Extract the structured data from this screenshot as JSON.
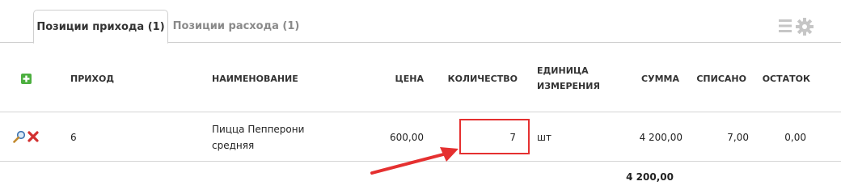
{
  "tabs": [
    {
      "label": "Позиции прихода (1)",
      "active": true
    },
    {
      "label": "Позиции расхода (1)",
      "active": false
    }
  ],
  "toolbar": {
    "icons": [
      "list-icon",
      "gear-icon"
    ]
  },
  "table": {
    "headers": {
      "prihod": "ПРИХОД",
      "name": "НАИМЕНОВАНИЕ",
      "price": "ЦЕНА",
      "qty": "КОЛИЧЕСТВО",
      "unit_line1": "ЕДИНИЦА",
      "unit_line2": "ИЗМЕРЕНИЯ",
      "sum": "СУММА",
      "written_off": "СПИСАНО",
      "rest": "ОСТАТОК"
    },
    "rows": [
      {
        "prihod": "6",
        "name_line1": "Пицца Пепперони",
        "name_line2": "средняя",
        "price": "600,00",
        "qty": "7",
        "unit": "шт",
        "sum": "4 200,00",
        "written_off": "7,00",
        "rest": "0,00"
      }
    ],
    "total": "4 200,00"
  },
  "colors": {
    "accent_green": "#4caf3f",
    "delete_red": "#d23030",
    "highlight_red": "#e53030"
  }
}
